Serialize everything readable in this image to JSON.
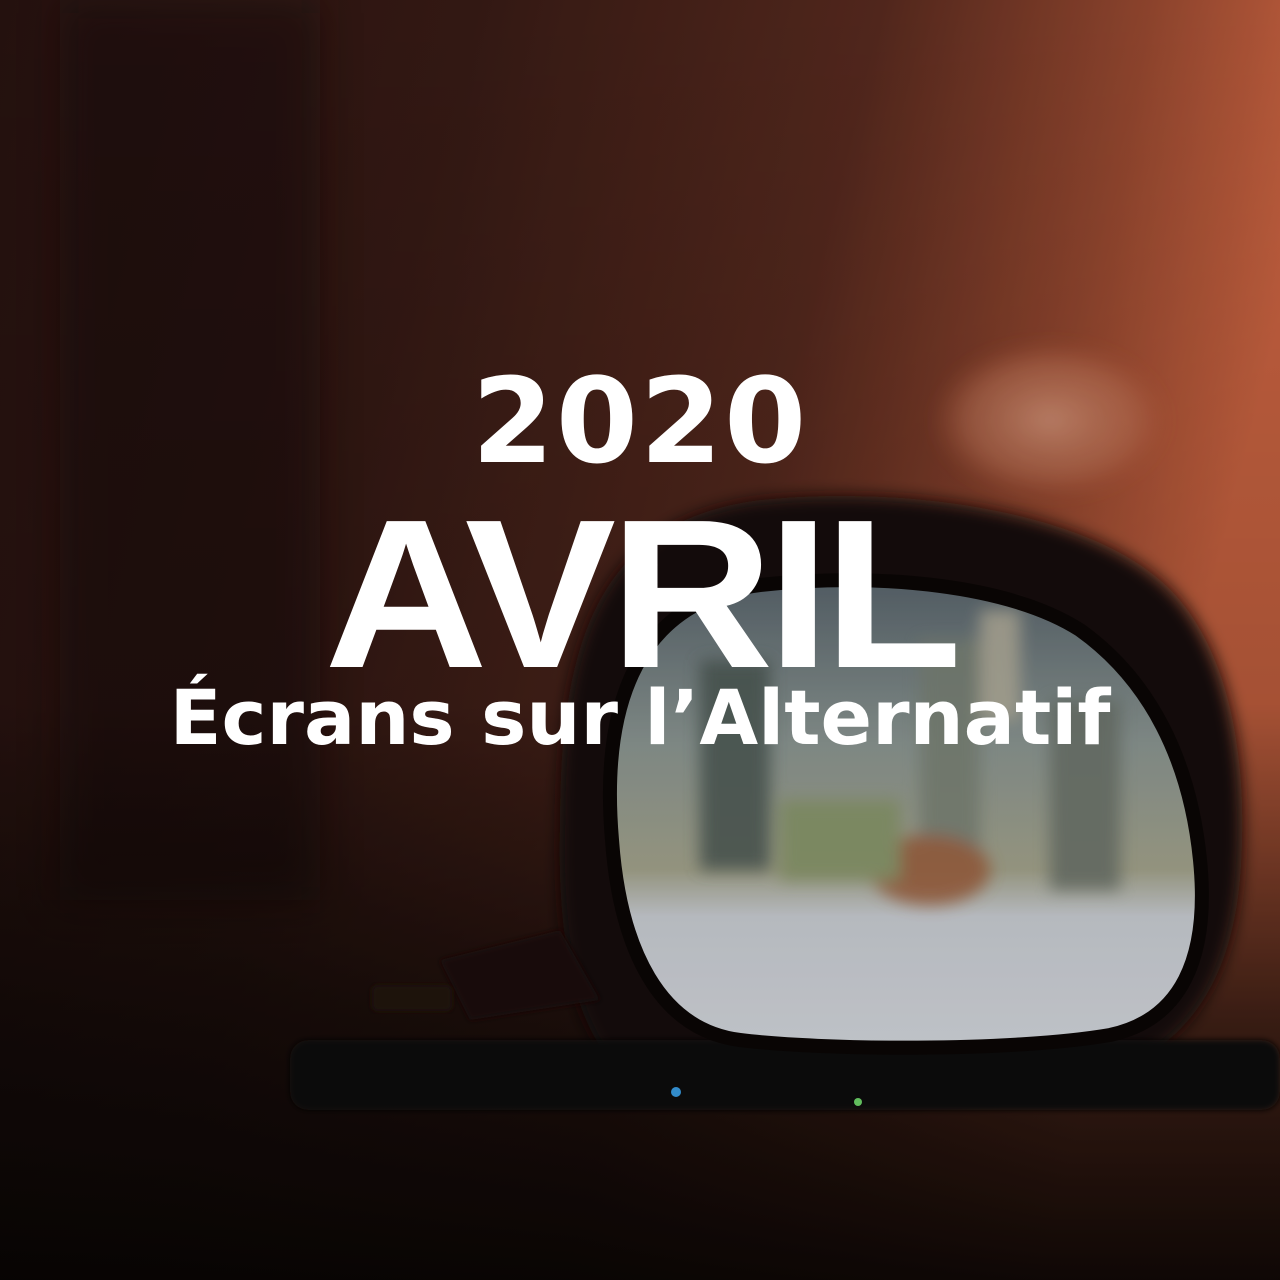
{
  "poster": {
    "year": "2020",
    "month": "AVRIL",
    "subtitle": "Écrans sur l’Alternatif"
  },
  "photo": {
    "subject": "eyeglasses-lens",
    "colors": {
      "background_dark": "#1a100c",
      "background_warm": "#d86a45",
      "frame": "#120a08",
      "lens": "#c9ccd2",
      "text": "#ffffff"
    }
  }
}
